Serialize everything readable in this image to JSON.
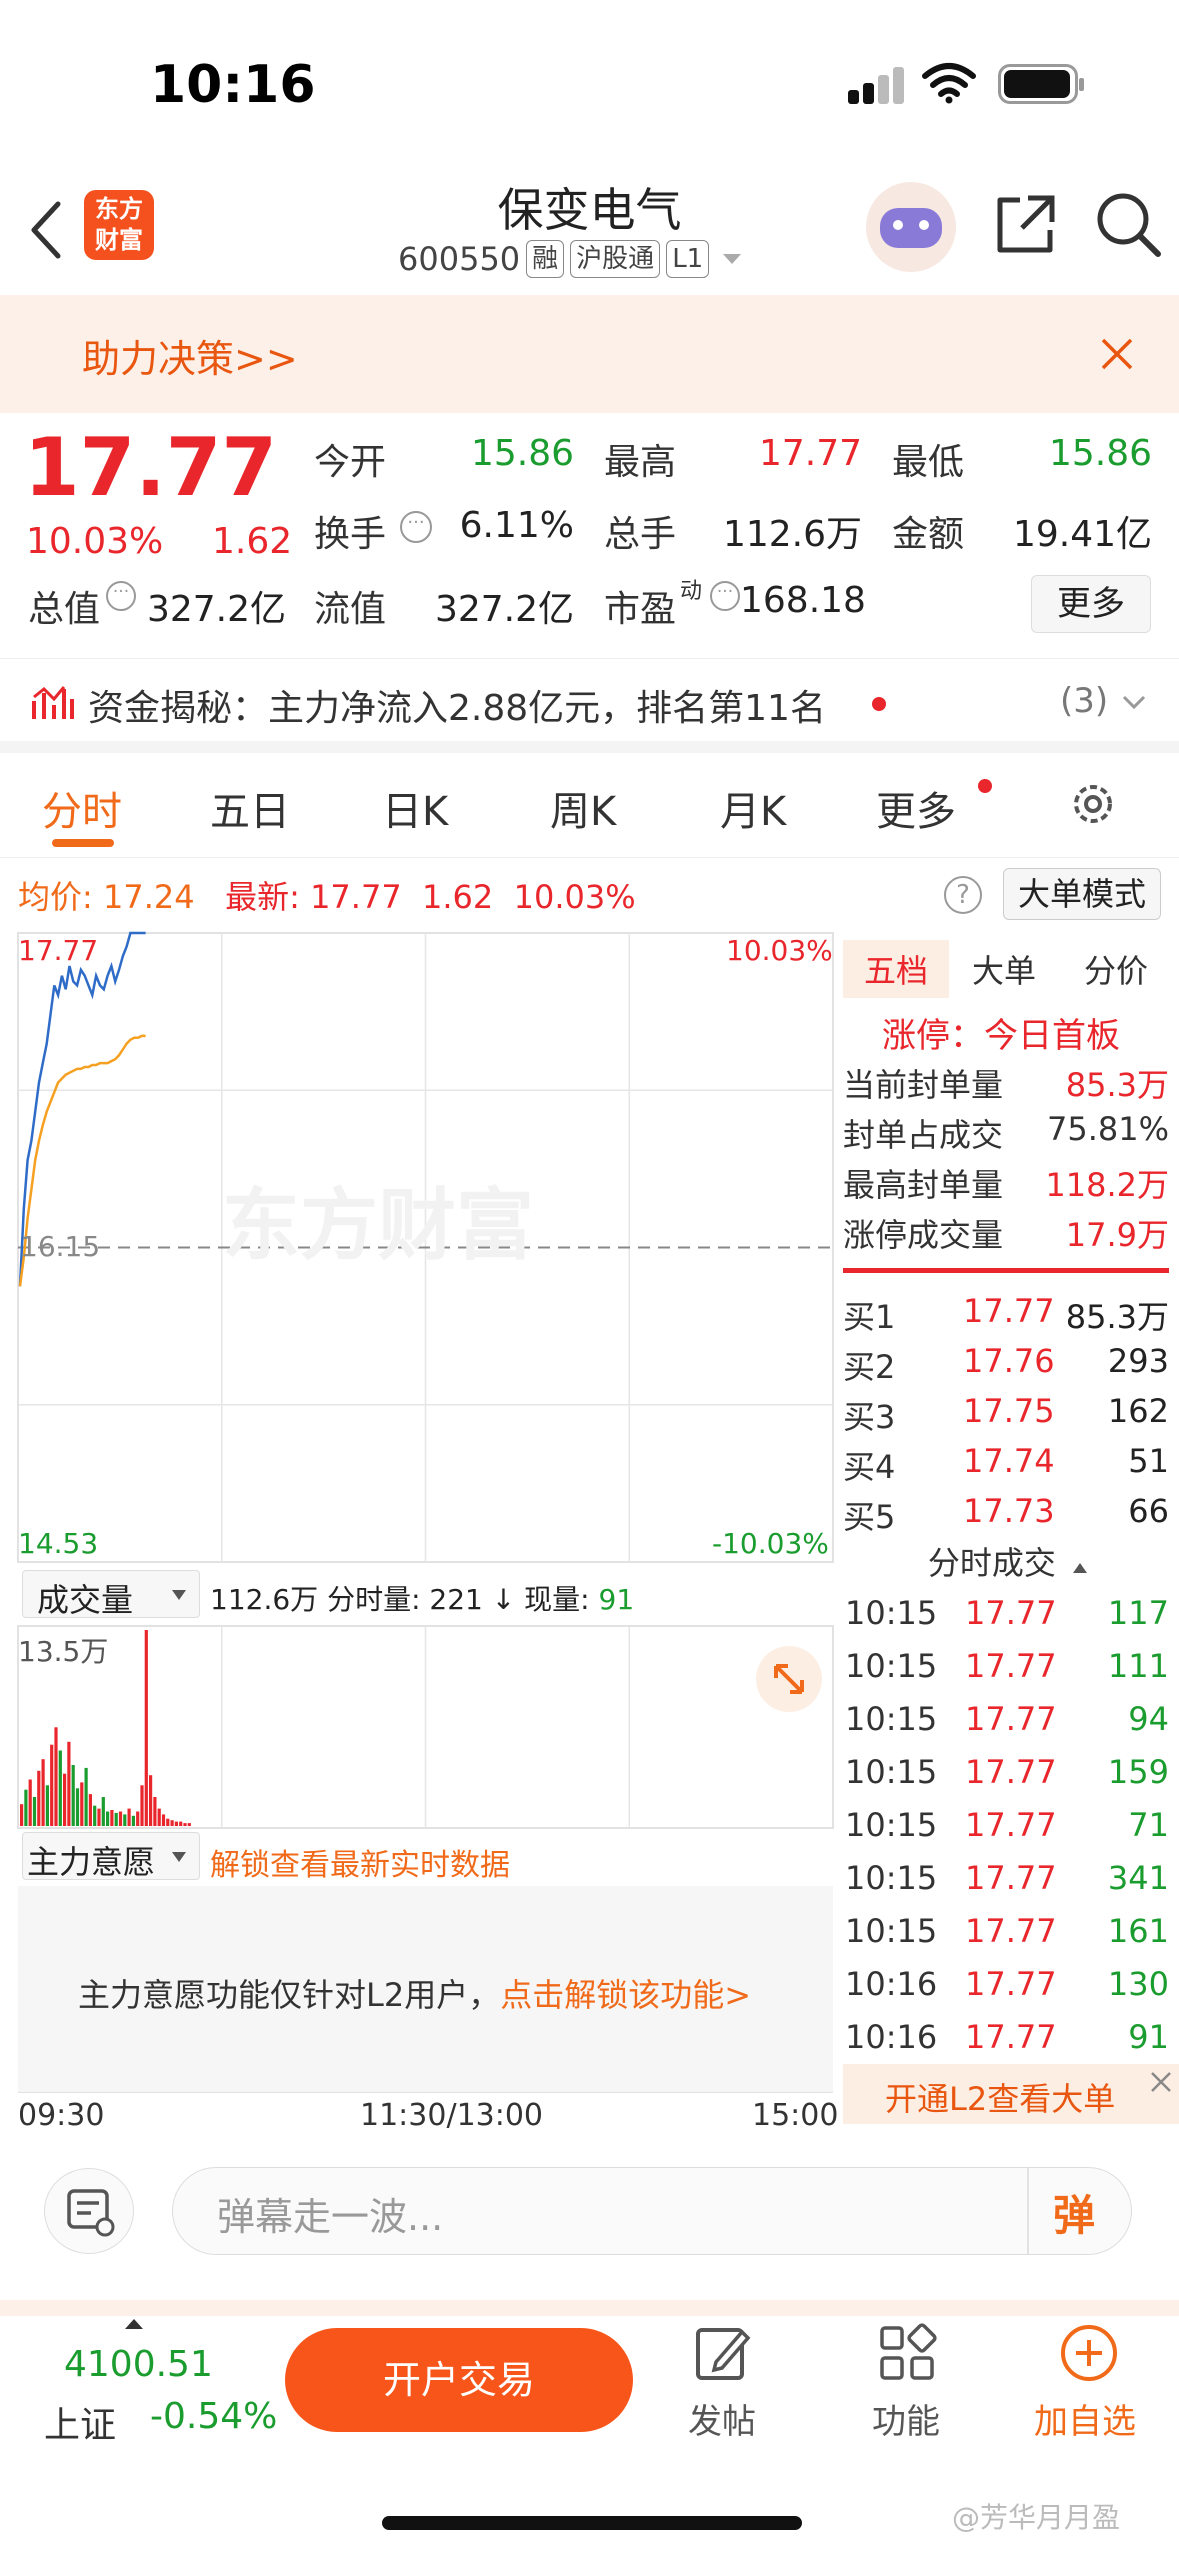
{
  "status": {
    "time": "10:16"
  },
  "header": {
    "name": "保变电气",
    "code": "600550",
    "tags": [
      "融",
      "沪股通",
      "L1"
    ],
    "logo_line1": "东方",
    "logo_line2": "财富"
  },
  "banner": {
    "text": "助力决策>>"
  },
  "quote": {
    "price": "17.77",
    "pct": "10.03%",
    "change": "1.62",
    "open_label": "今开",
    "open": "15.86",
    "high_label": "最高",
    "high": "17.77",
    "low_label": "最低",
    "low": "15.86",
    "turnover_label": "换手",
    "turnover": "6.11%",
    "volume_label": "总手",
    "volume": "112.6万",
    "amount_label": "金额",
    "amount": "19.41亿",
    "mktcap_label": "总值",
    "mktcap": "327.2亿",
    "float_label": "流值",
    "float": "327.2亿",
    "pe_label": "市盈",
    "pe_sup": "动",
    "pe": "168.18",
    "more": "更多"
  },
  "capital": {
    "text": "资金揭秘：主力净流入2.88亿元，排名第11名",
    "count": "(3)"
  },
  "tabs": [
    "分时",
    "五日",
    "日K",
    "周K",
    "月K",
    "更多"
  ],
  "avgline": {
    "avg_label": "均价:",
    "avg": "17.24",
    "latest_label": "最新:",
    "latest": "17.77",
    "chg": "1.62",
    "pct": "10.03%",
    "big_order_mode": "大单模式"
  },
  "chart": {
    "top_price": "17.77",
    "top_pct": "10.03%",
    "mid_price": "16.15",
    "bottom_price": "14.53",
    "bottom_pct": "-10.03%",
    "watermark": "东方财富",
    "volume_label": "成交量",
    "volume_total": "112.6万",
    "fenshi_label": "分时量:",
    "fenshi_val": "221",
    "current_label": "现量:",
    "current_val": "91",
    "vol_max": "13.5万",
    "zhuli_label": "主力意愿",
    "unlock_text": "解锁查看最新实时数据",
    "l2_text": "主力意愿功能仅针对L2用户，",
    "l2_link": "点击解锁该功能>",
    "time_start": "09:30",
    "time_mid": "11:30/13:00",
    "time_end": "15:00"
  },
  "chart_data": {
    "type": "line",
    "title": "",
    "ylim": [
      14.53,
      17.77
    ],
    "series": [
      {
        "name": "",
        "values": [
          15.95,
          16.35,
          16.6,
          16.7,
          16.85,
          17.0,
          17.1,
          17.2,
          17.35,
          17.5,
          17.45,
          17.55,
          17.48,
          17.6,
          17.52,
          17.5,
          17.58,
          17.55,
          17.5,
          17.45,
          17.55,
          17.5,
          17.48,
          17.55,
          17.6,
          17.52,
          17.58,
          17.65,
          17.7,
          17.77,
          17.77,
          17.77,
          17.77,
          17.77
        ]
      },
      {
        "name": "",
        "values": [
          15.95,
          16.1,
          16.3,
          16.45,
          16.6,
          16.7,
          16.78,
          16.85,
          16.9,
          16.95,
          17.0,
          17.02,
          17.04,
          17.05,
          17.06,
          17.07,
          17.07,
          17.08,
          17.08,
          17.09,
          17.09,
          17.1,
          17.1,
          17.1,
          17.11,
          17.12,
          17.14,
          17.17,
          17.2,
          17.22,
          17.23,
          17.23,
          17.24,
          17.24
        ]
      }
    ],
    "volume_ylim": [
      0,
      13.5
    ],
    "volume": [
      {
        "v": 1.5,
        "c": "red"
      },
      {
        "v": 2.5,
        "c": "green"
      },
      {
        "v": 3.2,
        "c": "red"
      },
      {
        "v": 2.0,
        "c": "green"
      },
      {
        "v": 3.8,
        "c": "red"
      },
      {
        "v": 4.6,
        "c": "red"
      },
      {
        "v": 2.8,
        "c": "green"
      },
      {
        "v": 5.6,
        "c": "red"
      },
      {
        "v": 6.8,
        "c": "red"
      },
      {
        "v": 5.2,
        "c": "green"
      },
      {
        "v": 3.6,
        "c": "red"
      },
      {
        "v": 5.8,
        "c": "red"
      },
      {
        "v": 4.2,
        "c": "green"
      },
      {
        "v": 2.6,
        "c": "green"
      },
      {
        "v": 3.0,
        "c": "red"
      },
      {
        "v": 4.0,
        "c": "green"
      },
      {
        "v": 2.2,
        "c": "red"
      },
      {
        "v": 1.4,
        "c": "green"
      },
      {
        "v": 1.2,
        "c": "red"
      },
      {
        "v": 2.0,
        "c": "green"
      },
      {
        "v": 1.0,
        "c": "green"
      },
      {
        "v": 1.1,
        "c": "red"
      },
      {
        "v": 0.9,
        "c": "green"
      },
      {
        "v": 1.0,
        "c": "red"
      },
      {
        "v": 0.8,
        "c": "green"
      },
      {
        "v": 1.2,
        "c": "red"
      },
      {
        "v": 0.7,
        "c": "green"
      },
      {
        "v": 1.0,
        "c": "red"
      },
      {
        "v": 2.8,
        "c": "red"
      },
      {
        "v": 13.5,
        "c": "red"
      },
      {
        "v": 3.5,
        "c": "red"
      },
      {
        "v": 2.0,
        "c": "red"
      },
      {
        "v": 1.2,
        "c": "red"
      },
      {
        "v": 0.8,
        "c": "red"
      },
      {
        "v": 0.5,
        "c": "red"
      },
      {
        "v": 0.4,
        "c": "red"
      },
      {
        "v": 0.3,
        "c": "red"
      },
      {
        "v": 0.3,
        "c": "red"
      },
      {
        "v": 0.2,
        "c": "red"
      },
      {
        "v": 0.2,
        "c": "red"
      }
    ]
  },
  "orderbook": {
    "tabs": [
      "五档",
      "大单",
      "分价"
    ],
    "limit_title": "涨停：今日首板",
    "stats": [
      {
        "label": "当前封单量",
        "value": "85.3万"
      },
      {
        "label": "封单占成交",
        "value": "75.81%"
      },
      {
        "label": "最高封单量",
        "value": "118.2万"
      },
      {
        "label": "涨停成交量",
        "value": "17.9万"
      }
    ],
    "bids": [
      {
        "label": "买1",
        "price": "17.77",
        "vol": "85.3万"
      },
      {
        "label": "买2",
        "price": "17.76",
        "vol": "293"
      },
      {
        "label": "买3",
        "price": "17.75",
        "vol": "162"
      },
      {
        "label": "买4",
        "price": "17.74",
        "vol": "51"
      },
      {
        "label": "买5",
        "price": "17.73",
        "vol": "66"
      }
    ],
    "ticks_title": "分时成交",
    "ticks": [
      {
        "time": "10:15",
        "price": "17.77",
        "vol": "117"
      },
      {
        "time": "10:15",
        "price": "17.77",
        "vol": "111"
      },
      {
        "time": "10:15",
        "price": "17.77",
        "vol": "94"
      },
      {
        "time": "10:15",
        "price": "17.77",
        "vol": "159"
      },
      {
        "time": "10:15",
        "price": "17.77",
        "vol": "71"
      },
      {
        "time": "10:15",
        "price": "17.77",
        "vol": "341"
      },
      {
        "time": "10:15",
        "price": "17.77",
        "vol": "161"
      },
      {
        "time": "10:16",
        "price": "17.77",
        "vol": "130"
      },
      {
        "time": "10:16",
        "price": "17.77",
        "vol": "91"
      }
    ],
    "l2_btn": "开通L2查看大单"
  },
  "danmu": {
    "placeholder": "弹幕走一波...",
    "btn": "弹"
  },
  "bottom": {
    "index_value": "4100.51",
    "index_name": "上证",
    "index_pct": "-0.54%",
    "trade": "开户交易",
    "post": "发帖",
    "func": "功能",
    "watch": "加自选"
  },
  "watermark_user": "@芳华月月盈"
}
